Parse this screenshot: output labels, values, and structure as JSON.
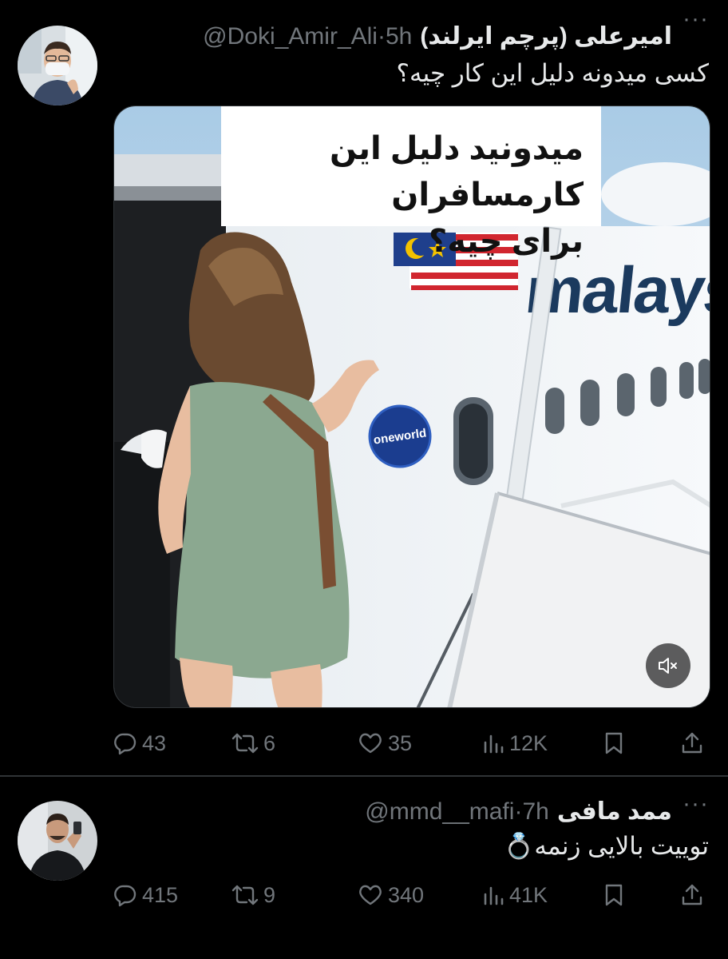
{
  "tweets": [
    {
      "display_name": "امیرعلی (پرچم ایرلند)",
      "handle": "@Doki_Amir_Ali",
      "time": "5h",
      "text": "کسی میدونه دلیل این کار چیه؟",
      "media": {
        "caption_line1": "میدونید دلیل این کارمسافران",
        "caption_line2": "برای چیه؟",
        "airline_logo": "malays",
        "badge": "oneworld"
      },
      "stats": {
        "replies": "43",
        "retweets": "6",
        "likes": "35",
        "views": "12K"
      }
    },
    {
      "display_name": "ممد مافی",
      "handle": "@mmd__mafi",
      "time": "7h",
      "text": "توییت بالایی زنمه💍",
      "stats": {
        "replies": "415",
        "retweets": "9",
        "likes": "340",
        "views": "41K"
      }
    }
  ],
  "icons": [
    "more-icon",
    "reply-icon",
    "retweet-icon",
    "like-icon",
    "views-icon",
    "bookmark-icon",
    "share-icon",
    "mute-icon"
  ],
  "colors": {
    "background": "#000000",
    "text": "#e7e9ea",
    "muted": "#71767b",
    "divider": "#2f3336"
  }
}
